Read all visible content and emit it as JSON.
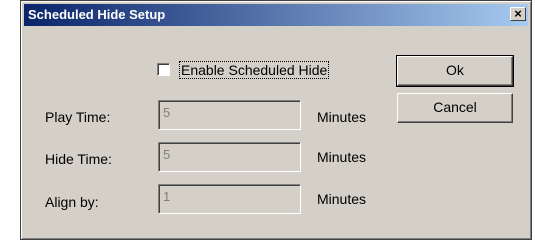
{
  "window": {
    "title": "Scheduled Hide Setup",
    "close_glyph": "×"
  },
  "options": {
    "enable_label": "Enable Scheduled Hide",
    "enable_checked": false
  },
  "fields": [
    {
      "label": "Play Time:",
      "value": "5",
      "unit": "Minutes"
    },
    {
      "label": "Hide Time:",
      "value": "5",
      "unit": "Minutes"
    },
    {
      "label": "Align by:",
      "value": "1",
      "unit": "Minutes"
    }
  ],
  "buttons": {
    "ok_label": "Ok",
    "cancel_label": "Cancel"
  }
}
